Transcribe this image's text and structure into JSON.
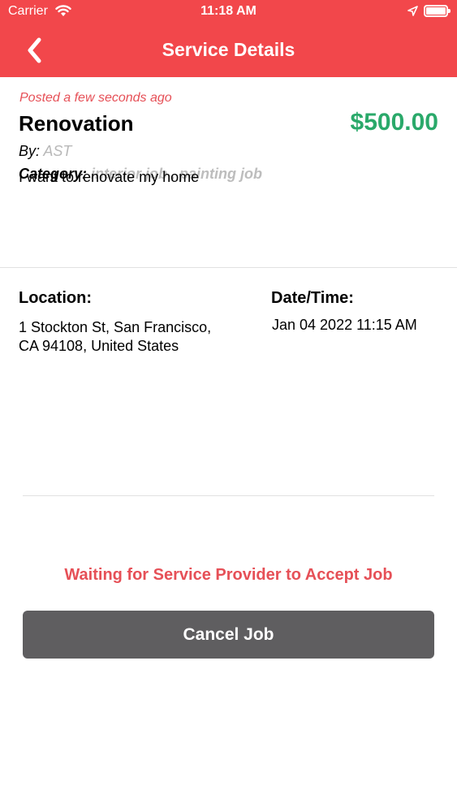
{
  "status_bar": {
    "carrier": "Carrier",
    "time": "11:18 AM",
    "icons": [
      "wifi-icon",
      "location-arrow-icon",
      "battery-icon"
    ]
  },
  "nav": {
    "title": "Service Details",
    "back_icon": "chevron-left-icon"
  },
  "service": {
    "posted": "Posted a few seconds ago",
    "title": "Renovation",
    "price": "$500.00",
    "by_label": "By:",
    "by_value": "AST",
    "category_label": "Category:",
    "category_value": "interior job , painting job",
    "description": "I want to renovate my home"
  },
  "details": {
    "location_label": "Location:",
    "location_value": "1 Stockton St, San Francisco, CA  94108, United States",
    "datetime_label": "Date/Time:",
    "datetime_value": "Jan 04 2022 11:15 AM"
  },
  "footer": {
    "status_text": "Waiting for Service Provider to Accept Job",
    "cancel_label": "Cancel Job"
  },
  "colors": {
    "header": "#f2474b",
    "accent_text": "#e65057",
    "price": "#2aa96a",
    "cancel_button": "#5f5e60"
  }
}
